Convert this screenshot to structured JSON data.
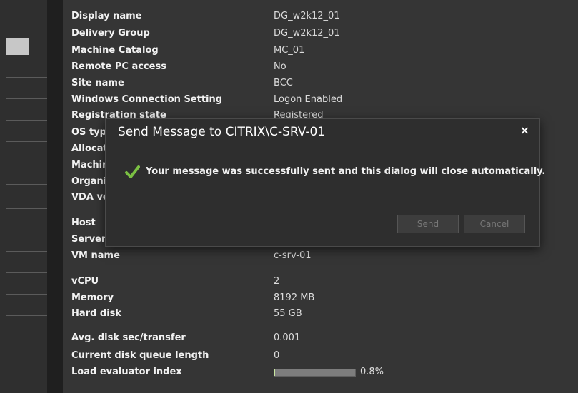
{
  "details": [
    {
      "label": "Display name",
      "value": "DG_w2k12_01"
    },
    {
      "label": "Delivery Group",
      "value": "DG_w2k12_01"
    },
    {
      "label": "Machine Catalog",
      "value": "MC_01"
    },
    {
      "label": "Remote PC access",
      "value": "No"
    },
    {
      "label": "Site name",
      "value": "BCC"
    },
    {
      "label": "Windows Connection Setting",
      "value": "Logon Enabled"
    },
    {
      "label": "Registration state",
      "value": "Registered"
    },
    {
      "label": "OS type",
      "value": ""
    },
    {
      "label": "Allocation type",
      "value": ""
    },
    {
      "label": "Machine",
      "value": ""
    },
    {
      "label": "Organization",
      "value": ""
    },
    {
      "label": "VDA version",
      "value": ""
    },
    {
      "label": "Host",
      "value": ""
    },
    {
      "label": "Server",
      "value": ""
    },
    {
      "label": "VM name",
      "value": "c-srv-01"
    },
    {
      "label": "vCPU",
      "value": "2"
    },
    {
      "label": "Memory",
      "value": "8192 MB"
    },
    {
      "label": "Hard disk",
      "value": "55 GB"
    },
    {
      "label": "Avg. disk sec/transfer",
      "value": "0.001"
    },
    {
      "label": "Current disk queue length",
      "value": "0"
    }
  ],
  "load_evaluator": {
    "label": "Load evaluator index",
    "value": "0.8%",
    "fraction": 0.008
  },
  "dialog": {
    "title": "Send Message to CITRIX\\C-SRV-01",
    "close": "×",
    "message": "Your message was successfully sent and this dialog will close automatically.",
    "send_label": "Send",
    "cancel_label": "Cancel"
  },
  "colors": {
    "check": "#7bc043",
    "background": "#353535"
  }
}
